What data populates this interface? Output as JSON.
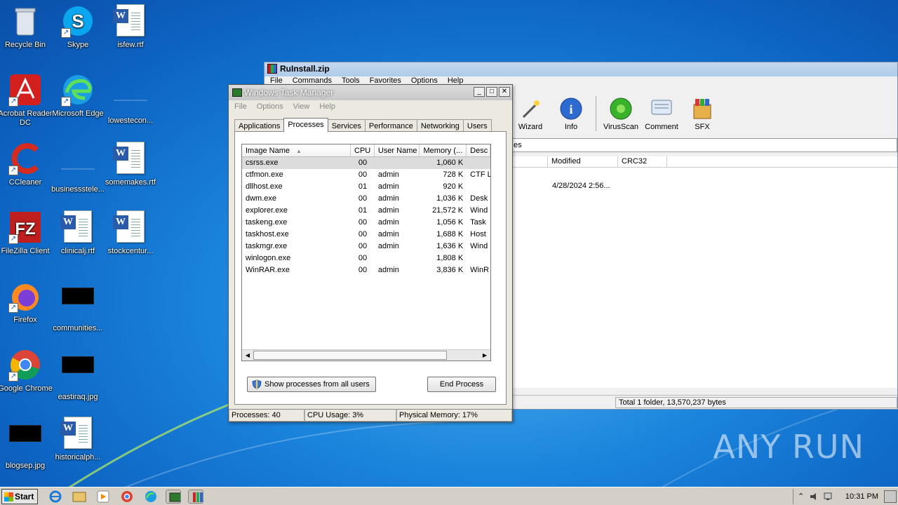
{
  "desktop": {
    "icons": [
      {
        "label": "Recycle Bin"
      },
      {
        "label": "Skype"
      },
      {
        "label": "isfew.rtf"
      },
      {
        "label": "Acrobat Reader DC"
      },
      {
        "label": "Microsoft Edge"
      },
      {
        "label": "lowestecon..."
      },
      {
        "label": "CCleaner"
      },
      {
        "label": "businessstele..."
      },
      {
        "label": "somemakes.rtf"
      },
      {
        "label": "FileZilla Client"
      },
      {
        "label": "clinicalj.rtf"
      },
      {
        "label": "stockcentur..."
      },
      {
        "label": "Firefox"
      },
      {
        "label": "communities..."
      },
      {
        "label": "Google Chrome"
      },
      {
        "label": "eastiraq.jpg"
      },
      {
        "label": "blogsep.jpg"
      },
      {
        "label": "historicalph..."
      }
    ]
  },
  "winrar": {
    "title": "RuInstall.zip",
    "menu": [
      "File",
      "Commands",
      "Tools",
      "Favorites",
      "Options",
      "Help"
    ],
    "toolbar": [
      "Wizard",
      "Info",
      "VirusScan",
      "Comment",
      "SFX"
    ],
    "address_fragment": "es",
    "columns": [
      "Modified",
      "CRC32"
    ],
    "row_modified": "4/28/2024 2:56...",
    "status": "Total 1 folder, 13,570,237 bytes"
  },
  "taskmanager": {
    "title": "Windows Task Manager",
    "menu": [
      "File",
      "Options",
      "View",
      "Help"
    ],
    "tabs": [
      "Applications",
      "Processes",
      "Services",
      "Performance",
      "Networking",
      "Users"
    ],
    "columns": [
      "Image Name",
      "CPU",
      "User Name",
      "Memory (...",
      "Desc"
    ],
    "rows": [
      {
        "name": "csrss.exe",
        "cpu": "00",
        "user": "",
        "mem": "1,060 K",
        "desc": ""
      },
      {
        "name": "ctfmon.exe",
        "cpu": "00",
        "user": "admin",
        "mem": "728 K",
        "desc": "CTF L"
      },
      {
        "name": "dllhost.exe",
        "cpu": "01",
        "user": "admin",
        "mem": "920 K",
        "desc": ""
      },
      {
        "name": "dwm.exe",
        "cpu": "00",
        "user": "admin",
        "mem": "1,036 K",
        "desc": "Desk"
      },
      {
        "name": "explorer.exe",
        "cpu": "01",
        "user": "admin",
        "mem": "21,572 K",
        "desc": "Wind"
      },
      {
        "name": "taskeng.exe",
        "cpu": "00",
        "user": "admin",
        "mem": "1,056 K",
        "desc": "Task"
      },
      {
        "name": "taskhost.exe",
        "cpu": "00",
        "user": "admin",
        "mem": "1,688 K",
        "desc": "Host"
      },
      {
        "name": "taskmgr.exe",
        "cpu": "00",
        "user": "admin",
        "mem": "1,636 K",
        "desc": "Wind"
      },
      {
        "name": "winlogon.exe",
        "cpu": "00",
        "user": "",
        "mem": "1,808 K",
        "desc": ""
      },
      {
        "name": "WinRAR.exe",
        "cpu": "00",
        "user": "admin",
        "mem": "3,836 K",
        "desc": "WinR"
      }
    ],
    "show_all_label": "Show processes from all users",
    "end_process_label": "End Process",
    "status": {
      "processes": "Processes: 40",
      "cpu": "CPU Usage: 3%",
      "memory": "Physical Memory: 17%"
    }
  },
  "taskbar": {
    "start_label": "Start",
    "clock": "10:31 PM"
  },
  "watermark": "ANY RUN",
  "colors": {
    "desktop": "#1a84dc",
    "taskbar": "#d4d0c8",
    "selection": "#dcdcdc"
  }
}
